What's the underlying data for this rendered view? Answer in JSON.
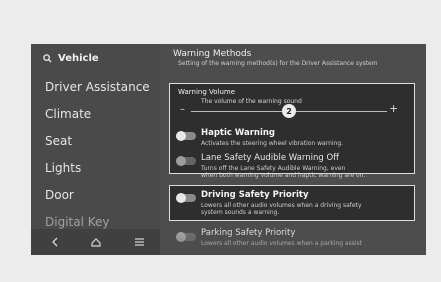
{
  "sidebar": {
    "search_label": "Vehicle",
    "items": [
      {
        "label": "Driver Assistance"
      },
      {
        "label": "Climate"
      },
      {
        "label": "Seat"
      },
      {
        "label": "Lights"
      },
      {
        "label": "Door"
      },
      {
        "label": "Digital Key"
      }
    ],
    "nav_icons": [
      "back-icon",
      "home-icon",
      "menu-icon"
    ]
  },
  "section": {
    "title": "Warning Methods",
    "description": "Setting of the warning method(s) for the Driver Assistance system"
  },
  "warning_volume": {
    "label": "Warning Volume",
    "description": "The volume of the warning sound",
    "value": "2",
    "level_fraction": 0.5,
    "minus": "–",
    "plus": "+"
  },
  "options": [
    {
      "title": "Haptic Warning",
      "desc_lines": [
        "Activates the steering wheel vibration warning."
      ],
      "enabled": false
    },
    {
      "title": "Lane Safety Audible Warning Off",
      "desc_lines": [
        "Turns off the Lane Safety Audible Warning, even",
        "when both warning volume and haptic warning are on."
      ],
      "enabled": false
    },
    {
      "title": "Driving Safety Priority",
      "desc_lines": [
        "Lowers all other audio volumes when a driving safety",
        "system sounds a warning."
      ],
      "enabled": false
    },
    {
      "title": "Parking Safety Priority",
      "desc_lines": [
        "Lowers all other audio volumes when a parking assist"
      ],
      "enabled": false
    }
  ]
}
